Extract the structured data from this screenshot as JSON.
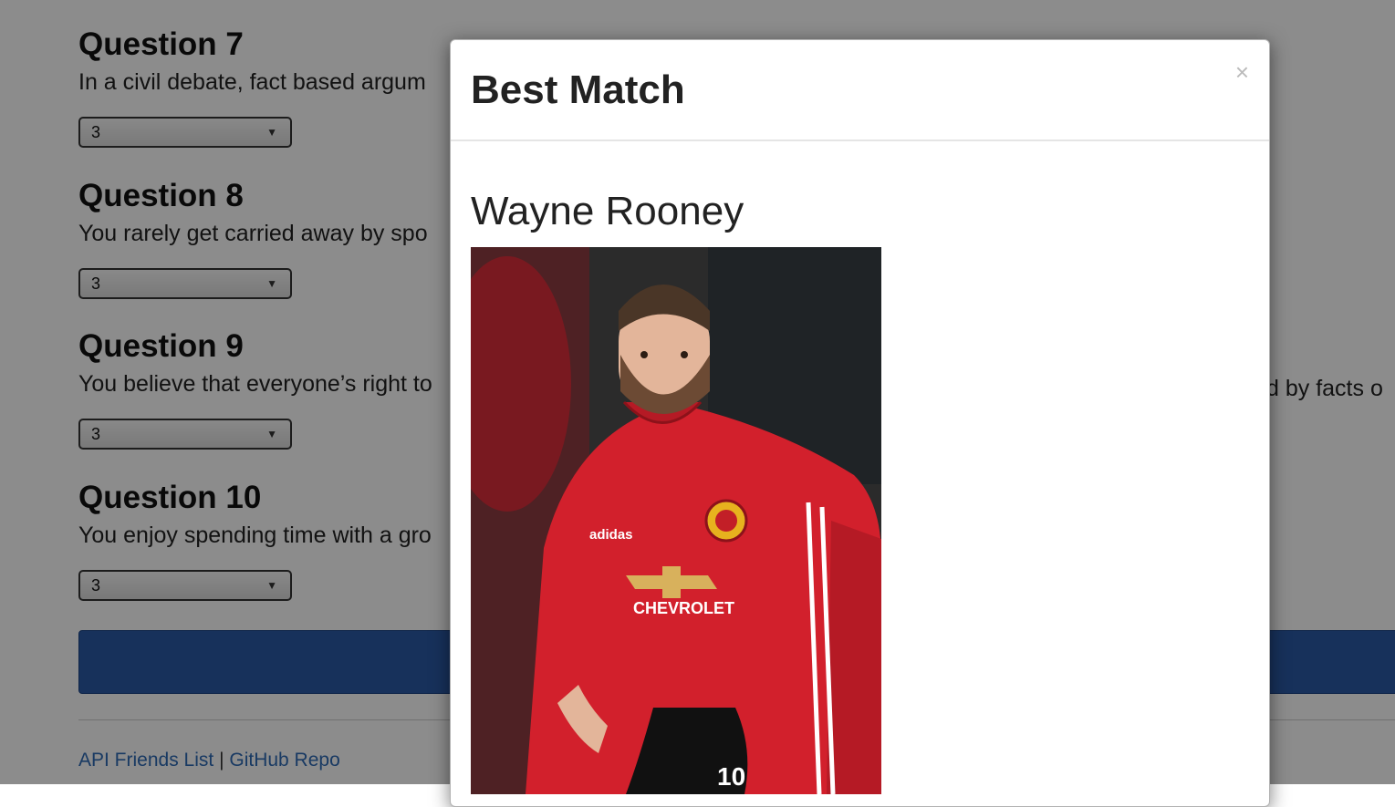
{
  "questions": [
    {
      "title": "Question 7",
      "text": "In a civil debate, fact based argum",
      "value": "3"
    },
    {
      "title": "Question 8",
      "text": "You rarely get carried away by spo",
      "value": "3"
    },
    {
      "title": "Question 9",
      "text": "You believe that everyone’s right to",
      "value": "3"
    },
    {
      "title": "Question 10",
      "text": "You enjoy spending time with a gro",
      "value": "3"
    }
  ],
  "question9_right_tail": "d by facts o",
  "footer": {
    "api_link": "API Friends List",
    "separator": " | ",
    "github_link": "GitHub Repo"
  },
  "modal": {
    "title": "Best Match",
    "close_symbol": "×",
    "match_name": "Wayne Rooney"
  },
  "photo": {
    "jersey_brand": "adidas",
    "jersey_sponsor": "CHEVROLET",
    "jersey_number": "10"
  },
  "colors": {
    "submit_button": "#2a5aa6",
    "link": "#2e6ab5",
    "jersey_red": "#d2202c"
  }
}
